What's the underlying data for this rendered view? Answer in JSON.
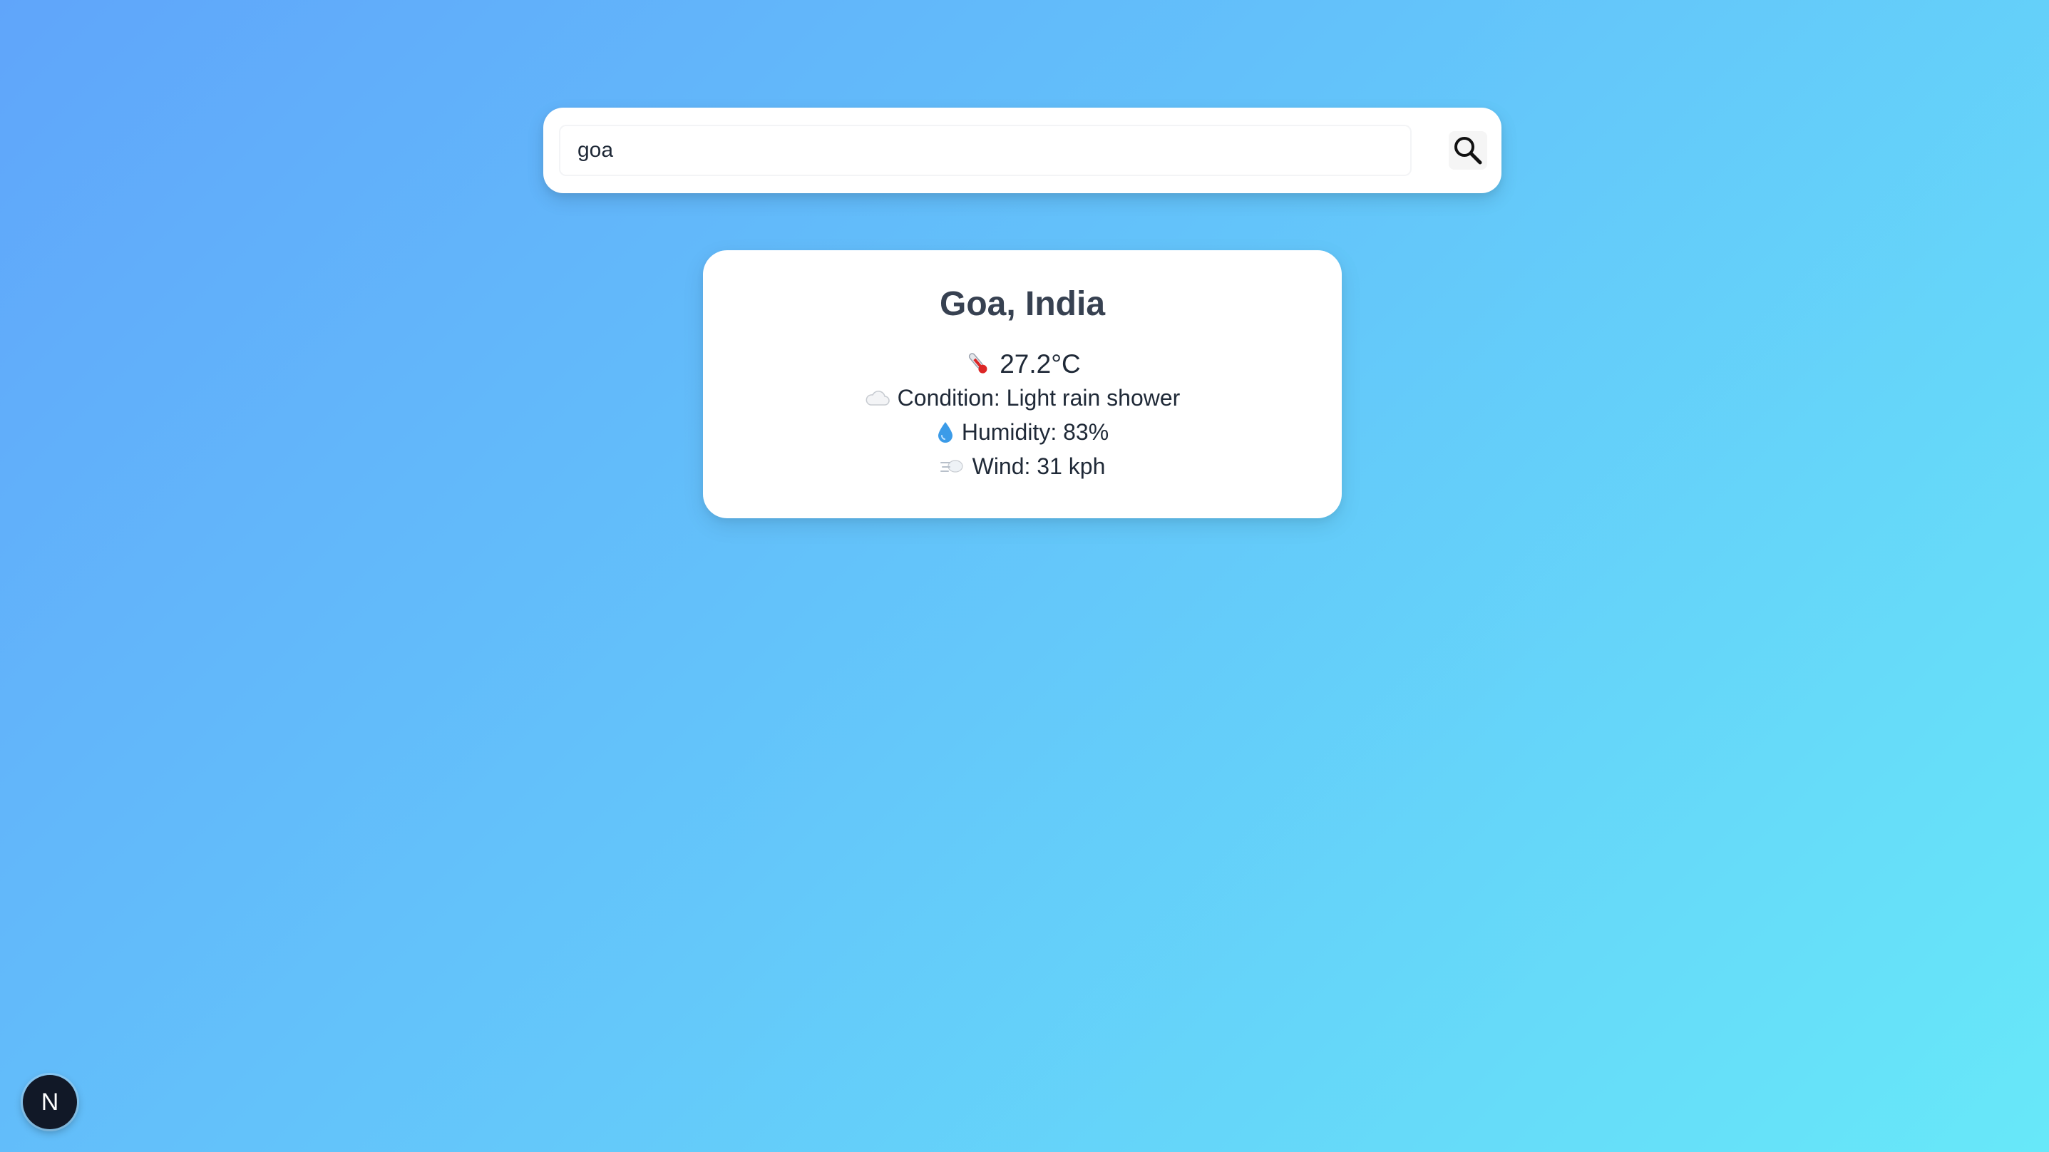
{
  "search": {
    "value": "goa",
    "placeholder": "",
    "button_icon": "search-icon"
  },
  "weather": {
    "location": "Goa, India",
    "temperature": "27.2°C",
    "condition": "Condition: Light rain shower",
    "humidity": "Humidity: 83%",
    "wind": "Wind: 31 kph",
    "icons": {
      "temperature": "thermometer-icon",
      "condition": "cloud-icon",
      "humidity": "droplet-icon",
      "wind": "wind-icon"
    }
  },
  "dev_badge": {
    "label": "N"
  },
  "colors": {
    "gradient_start": "#60a5fa",
    "gradient_end": "#67e8f9",
    "card_bg": "#ffffff",
    "text_dark": "#374151",
    "badge_bg": "#111827"
  }
}
